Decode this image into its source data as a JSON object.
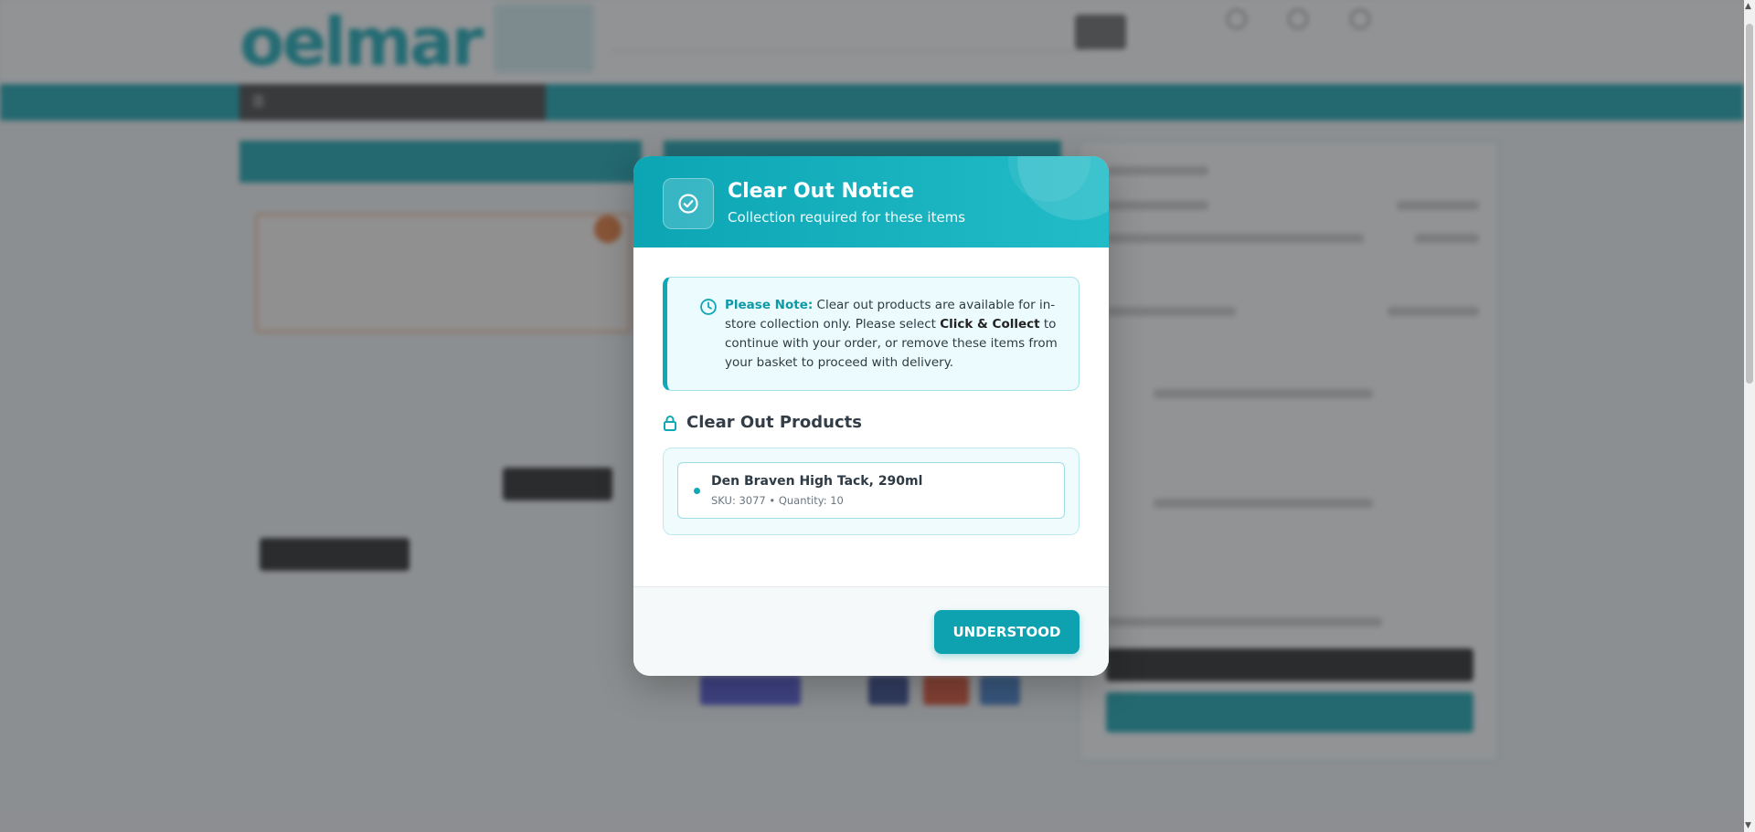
{
  "modal": {
    "title": "Clear Out Notice",
    "subtitle": "Collection required for these items",
    "note": {
      "lead": "Please Note:",
      "text1": " Clear out products are available for in-store collection only. Please select ",
      "emphasis": "Click & Collect",
      "text2": " to continue with your order, or remove these items from your basket to proceed with delivery."
    },
    "section_title": "Clear Out Products",
    "products": [
      {
        "name": "Den Braven High Tack, 290ml",
        "meta": "SKU: 3077 • Quantity: 10"
      }
    ],
    "confirm_label": "UNDERSTOOD",
    "icons": {
      "header": "check-circle-icon",
      "note": "clock-icon",
      "section": "lock-icon"
    }
  },
  "colors": {
    "accent": "#0ea2b0",
    "note_background": "#ecfbfd",
    "overlay": "rgba(55,58,62,0.55)"
  }
}
